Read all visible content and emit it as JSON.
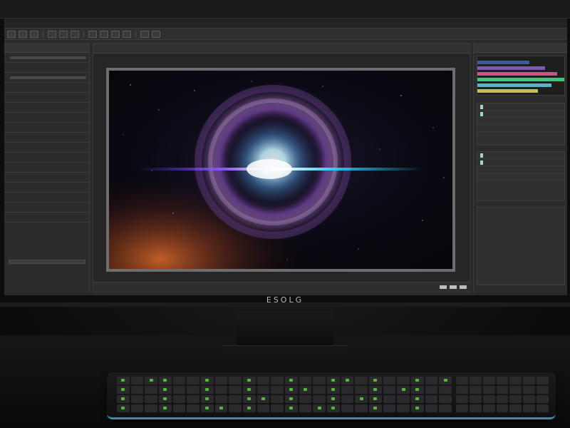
{
  "app": {
    "title": "",
    "brand": "ESOLG"
  },
  "left_panel": {
    "header": "",
    "rows": [
      "",
      "",
      "",
      "",
      "",
      "",
      "",
      "",
      "",
      "",
      "",
      "",
      "",
      "",
      "",
      "",
      "",
      "",
      "",
      ""
    ]
  },
  "canvas": {
    "tab_label": "",
    "image_description_icon": "nebula-image"
  },
  "right_panel": {
    "header": ""
  },
  "keyboard": {
    "brand": ""
  },
  "colors": {
    "accent_cyan": "#3f8ca3",
    "key_glow": "#55b83a",
    "nebula_purple": "#7b4fa6",
    "nebula_core": "#b7f3ff"
  }
}
